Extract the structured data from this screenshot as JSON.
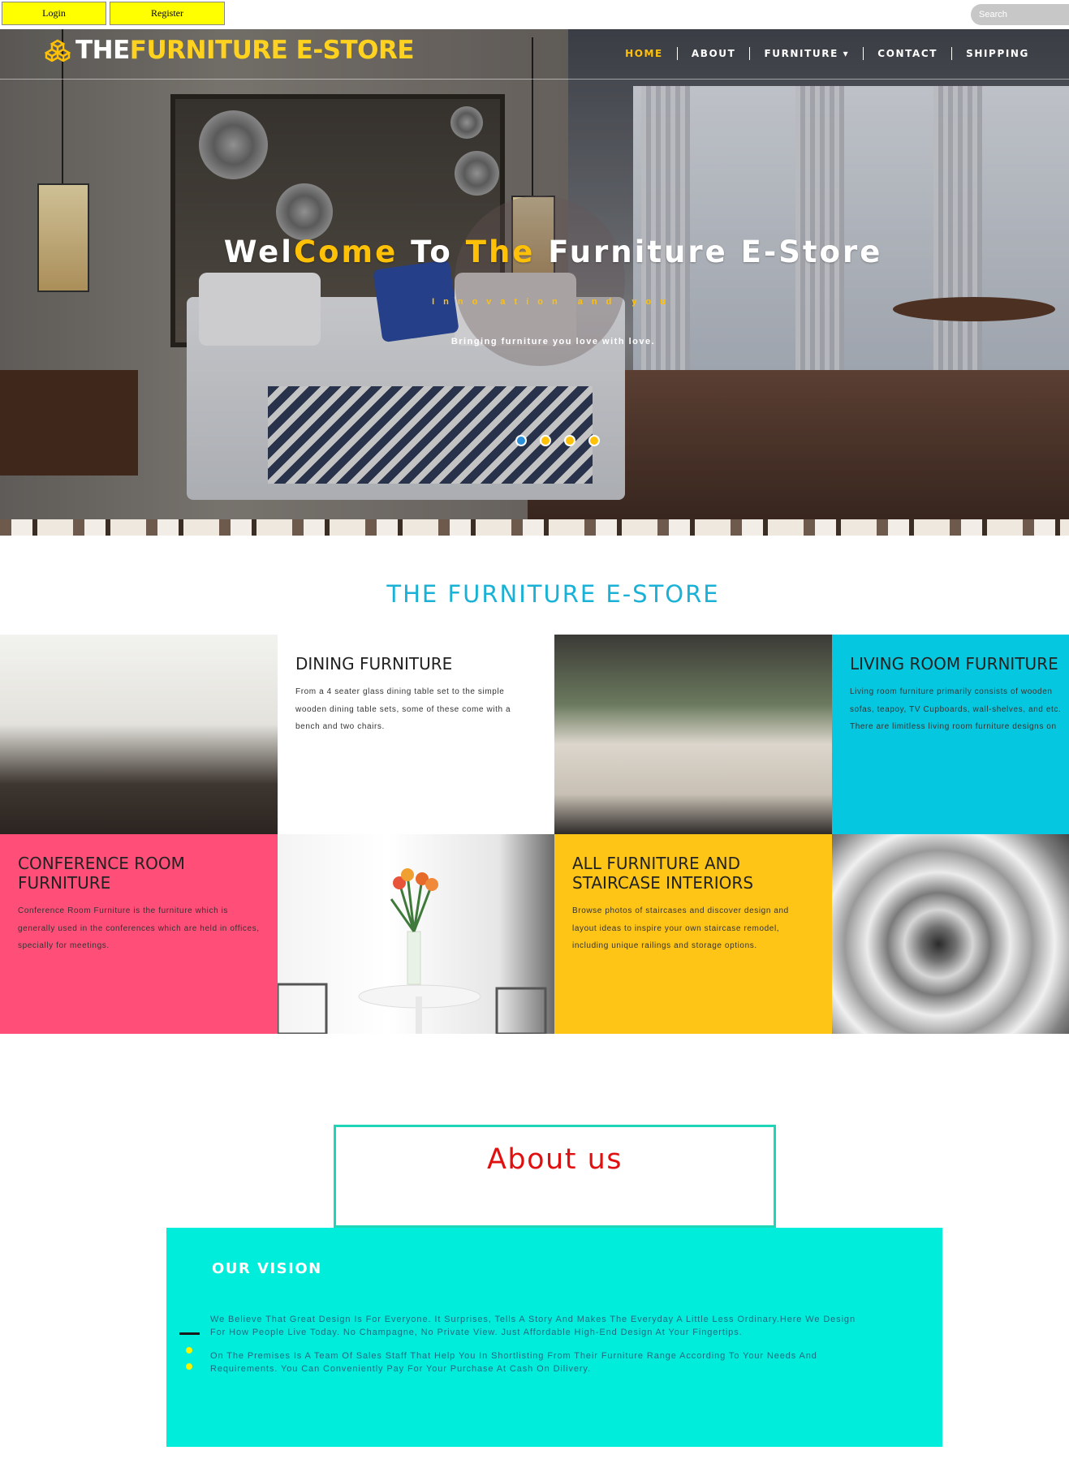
{
  "topbar": {
    "login_label": "Login",
    "register_label": "Register",
    "search_placeholder": "Search"
  },
  "brand": {
    "part1": "THE ",
    "part2": "FURNITURE E-STORE"
  },
  "nav": {
    "items": [
      "HOME",
      "ABOUT",
      "FURNITURE ▾",
      "CONTACT",
      "SHIPPING"
    ]
  },
  "hero": {
    "title_1": "Wel",
    "title_2": "Come",
    "title_3": " To ",
    "title_4": "The",
    "title_5": " Furniture E-Store",
    "subtitle": "Innovation and you",
    "tagline": "Bringing furniture you love with love."
  },
  "section": {
    "title": "THE FURNITURE E-STORE"
  },
  "tiles": {
    "dining": {
      "title": "DINING FURNITURE",
      "body": "From a 4 seater glass dining table set to the simple wooden dining table sets, some of these come with a bench and two chairs."
    },
    "living": {
      "title": "LIVING ROOM FURNITURE",
      "line1": "Living room furniture primarily consists of wooden",
      "line2": "sofas, teapoy, TV Cupboards, wall-shelves, and etc.",
      "line3": "There are limitless living room furniture designs on"
    },
    "conference": {
      "title": "CONFERENCE ROOM FURNITURE",
      "body": "Conference Room Furniture is the furniture which is generally used in the conferences which are held in offices, specially for meetings."
    },
    "staircase": {
      "title": "ALL FURNITURE AND STAIRCASE INTERIORS",
      "body": "Browse photos of staircases and discover design and layout ideas to inspire your own staircase remodel, including unique railings and storage options."
    }
  },
  "about": {
    "title": "About us",
    "vision_title": "OUR VISION",
    "para1": "We Believe That Great Design Is For Everyone. It Surprises, Tells A Story And Makes The Everyday A Little Less Ordinary.Here We Design For How People Live Today. No Champagne, No Private View. Just Affordable High-End Design At Your Fingertips.",
    "para2": "On The Premises Is A Team Of Sales Staff That Help You In Shortlisting From Their Furniture Range According To Your Needs And Requirements. You Can Conveniently Pay For Your Purchase At Cash On Dilivery."
  },
  "colors": {
    "accent_yellow": "#ffc107",
    "brand_cyan": "#19b2d6",
    "living_cyan": "#05c8e0",
    "conference_pink": "#ff4f78",
    "staircase_yellow": "#fec517",
    "vision_teal": "#00eddc",
    "about_red": "#e01010"
  }
}
